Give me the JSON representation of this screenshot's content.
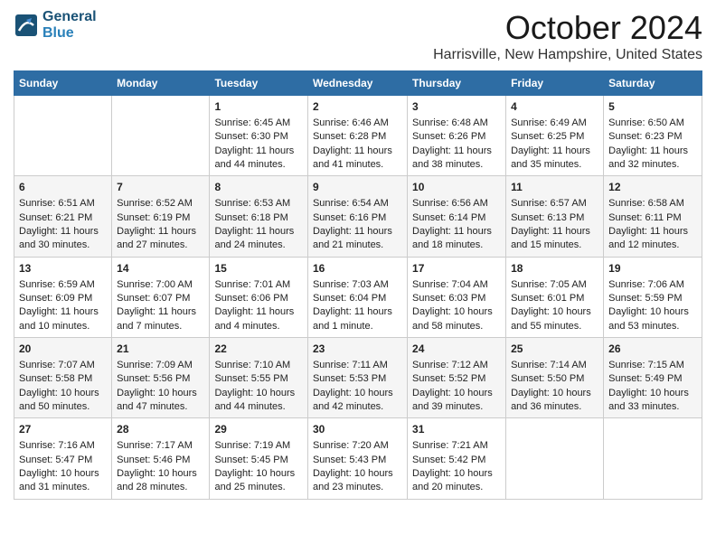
{
  "header": {
    "logo_line1": "General",
    "logo_line2": "Blue",
    "month": "October 2024",
    "location": "Harrisville, New Hampshire, United States"
  },
  "weekdays": [
    "Sunday",
    "Monday",
    "Tuesday",
    "Wednesday",
    "Thursday",
    "Friday",
    "Saturday"
  ],
  "weeks": [
    [
      {
        "day": "",
        "sunrise": "",
        "sunset": "",
        "daylight": ""
      },
      {
        "day": "",
        "sunrise": "",
        "sunset": "",
        "daylight": ""
      },
      {
        "day": "1",
        "sunrise": "Sunrise: 6:45 AM",
        "sunset": "Sunset: 6:30 PM",
        "daylight": "Daylight: 11 hours and 44 minutes."
      },
      {
        "day": "2",
        "sunrise": "Sunrise: 6:46 AM",
        "sunset": "Sunset: 6:28 PM",
        "daylight": "Daylight: 11 hours and 41 minutes."
      },
      {
        "day": "3",
        "sunrise": "Sunrise: 6:48 AM",
        "sunset": "Sunset: 6:26 PM",
        "daylight": "Daylight: 11 hours and 38 minutes."
      },
      {
        "day": "4",
        "sunrise": "Sunrise: 6:49 AM",
        "sunset": "Sunset: 6:25 PM",
        "daylight": "Daylight: 11 hours and 35 minutes."
      },
      {
        "day": "5",
        "sunrise": "Sunrise: 6:50 AM",
        "sunset": "Sunset: 6:23 PM",
        "daylight": "Daylight: 11 hours and 32 minutes."
      }
    ],
    [
      {
        "day": "6",
        "sunrise": "Sunrise: 6:51 AM",
        "sunset": "Sunset: 6:21 PM",
        "daylight": "Daylight: 11 hours and 30 minutes."
      },
      {
        "day": "7",
        "sunrise": "Sunrise: 6:52 AM",
        "sunset": "Sunset: 6:19 PM",
        "daylight": "Daylight: 11 hours and 27 minutes."
      },
      {
        "day": "8",
        "sunrise": "Sunrise: 6:53 AM",
        "sunset": "Sunset: 6:18 PM",
        "daylight": "Daylight: 11 hours and 24 minutes."
      },
      {
        "day": "9",
        "sunrise": "Sunrise: 6:54 AM",
        "sunset": "Sunset: 6:16 PM",
        "daylight": "Daylight: 11 hours and 21 minutes."
      },
      {
        "day": "10",
        "sunrise": "Sunrise: 6:56 AM",
        "sunset": "Sunset: 6:14 PM",
        "daylight": "Daylight: 11 hours and 18 minutes."
      },
      {
        "day": "11",
        "sunrise": "Sunrise: 6:57 AM",
        "sunset": "Sunset: 6:13 PM",
        "daylight": "Daylight: 11 hours and 15 minutes."
      },
      {
        "day": "12",
        "sunrise": "Sunrise: 6:58 AM",
        "sunset": "Sunset: 6:11 PM",
        "daylight": "Daylight: 11 hours and 12 minutes."
      }
    ],
    [
      {
        "day": "13",
        "sunrise": "Sunrise: 6:59 AM",
        "sunset": "Sunset: 6:09 PM",
        "daylight": "Daylight: 11 hours and 10 minutes."
      },
      {
        "day": "14",
        "sunrise": "Sunrise: 7:00 AM",
        "sunset": "Sunset: 6:07 PM",
        "daylight": "Daylight: 11 hours and 7 minutes."
      },
      {
        "day": "15",
        "sunrise": "Sunrise: 7:01 AM",
        "sunset": "Sunset: 6:06 PM",
        "daylight": "Daylight: 11 hours and 4 minutes."
      },
      {
        "day": "16",
        "sunrise": "Sunrise: 7:03 AM",
        "sunset": "Sunset: 6:04 PM",
        "daylight": "Daylight: 11 hours and 1 minute."
      },
      {
        "day": "17",
        "sunrise": "Sunrise: 7:04 AM",
        "sunset": "Sunset: 6:03 PM",
        "daylight": "Daylight: 10 hours and 58 minutes."
      },
      {
        "day": "18",
        "sunrise": "Sunrise: 7:05 AM",
        "sunset": "Sunset: 6:01 PM",
        "daylight": "Daylight: 10 hours and 55 minutes."
      },
      {
        "day": "19",
        "sunrise": "Sunrise: 7:06 AM",
        "sunset": "Sunset: 5:59 PM",
        "daylight": "Daylight: 10 hours and 53 minutes."
      }
    ],
    [
      {
        "day": "20",
        "sunrise": "Sunrise: 7:07 AM",
        "sunset": "Sunset: 5:58 PM",
        "daylight": "Daylight: 10 hours and 50 minutes."
      },
      {
        "day": "21",
        "sunrise": "Sunrise: 7:09 AM",
        "sunset": "Sunset: 5:56 PM",
        "daylight": "Daylight: 10 hours and 47 minutes."
      },
      {
        "day": "22",
        "sunrise": "Sunrise: 7:10 AM",
        "sunset": "Sunset: 5:55 PM",
        "daylight": "Daylight: 10 hours and 44 minutes."
      },
      {
        "day": "23",
        "sunrise": "Sunrise: 7:11 AM",
        "sunset": "Sunset: 5:53 PM",
        "daylight": "Daylight: 10 hours and 42 minutes."
      },
      {
        "day": "24",
        "sunrise": "Sunrise: 7:12 AM",
        "sunset": "Sunset: 5:52 PM",
        "daylight": "Daylight: 10 hours and 39 minutes."
      },
      {
        "day": "25",
        "sunrise": "Sunrise: 7:14 AM",
        "sunset": "Sunset: 5:50 PM",
        "daylight": "Daylight: 10 hours and 36 minutes."
      },
      {
        "day": "26",
        "sunrise": "Sunrise: 7:15 AM",
        "sunset": "Sunset: 5:49 PM",
        "daylight": "Daylight: 10 hours and 33 minutes."
      }
    ],
    [
      {
        "day": "27",
        "sunrise": "Sunrise: 7:16 AM",
        "sunset": "Sunset: 5:47 PM",
        "daylight": "Daylight: 10 hours and 31 minutes."
      },
      {
        "day": "28",
        "sunrise": "Sunrise: 7:17 AM",
        "sunset": "Sunset: 5:46 PM",
        "daylight": "Daylight: 10 hours and 28 minutes."
      },
      {
        "day": "29",
        "sunrise": "Sunrise: 7:19 AM",
        "sunset": "Sunset: 5:45 PM",
        "daylight": "Daylight: 10 hours and 25 minutes."
      },
      {
        "day": "30",
        "sunrise": "Sunrise: 7:20 AM",
        "sunset": "Sunset: 5:43 PM",
        "daylight": "Daylight: 10 hours and 23 minutes."
      },
      {
        "day": "31",
        "sunrise": "Sunrise: 7:21 AM",
        "sunset": "Sunset: 5:42 PM",
        "daylight": "Daylight: 10 hours and 20 minutes."
      },
      {
        "day": "",
        "sunrise": "",
        "sunset": "",
        "daylight": ""
      },
      {
        "day": "",
        "sunrise": "",
        "sunset": "",
        "daylight": ""
      }
    ]
  ]
}
